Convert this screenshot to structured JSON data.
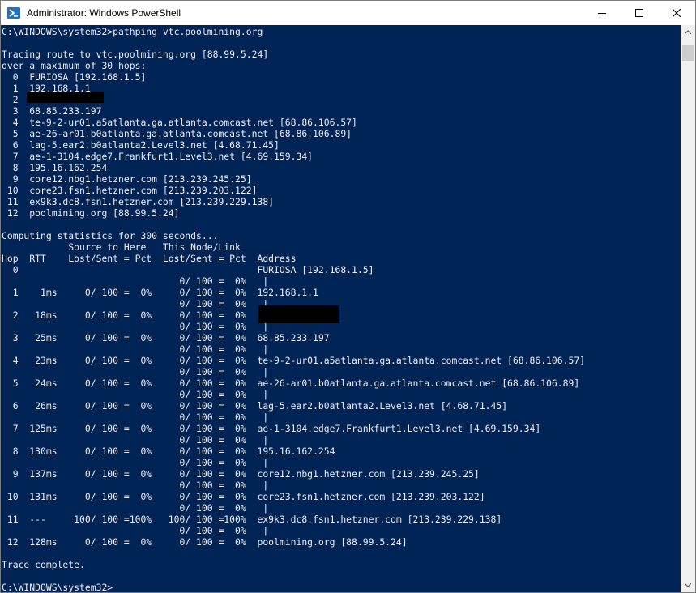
{
  "window": {
    "title": "Administrator: Windows PowerShell",
    "icon": "powershell-icon",
    "controls": [
      "minimize-icon",
      "maximize-icon",
      "close-icon"
    ],
    "colors": {
      "console_bg": "#012456",
      "console_fg": "#eeedf0",
      "titlebar_bg": "#ffffff"
    }
  },
  "console": {
    "lines": [
      "C:\\WINDOWS\\system32>pathping vtc.poolmining.org",
      "",
      "Tracing route to vtc.poolmining.org [88.99.5.24]",
      "over a maximum of 30 hops:",
      "  0  FURIOSA [192.168.1.5]",
      "  1  192.168.1.1",
      "  2",
      "  3  68.85.233.197",
      "  4  te-9-2-ur01.a5atlanta.ga.atlanta.comcast.net [68.86.106.57]",
      "  5  ae-26-ar01.b0atlanta.ga.atlanta.comcast.net [68.86.106.89]",
      "  6  lag-5.ear2.b0atlanta2.Level3.net [4.68.71.45]",
      "  7  ae-1-3104.edge7.Frankfurt1.Level3.net [4.69.159.34]",
      "  8  195.16.162.254",
      "  9  core12.nbg1.hetzner.com [213.239.245.25]",
      " 10  core23.fsn1.hetzner.com [213.239.203.122]",
      " 11  ex9k3.dc8.fsn1.hetzner.com [213.239.229.138]",
      " 12  poolmining.org [88.99.5.24]",
      "",
      "Computing statistics for 300 seconds...",
      "            Source to Here   This Node/Link",
      "Hop  RTT    Lost/Sent = Pct  Lost/Sent = Pct  Address",
      "  0                                           FURIOSA [192.168.1.5]",
      "                                0/ 100 =  0%   |",
      "  1    1ms     0/ 100 =  0%     0/ 100 =  0%  192.168.1.1",
      "                                0/ 100 =  0%   |",
      "  2   18ms     0/ 100 =  0%     0/ 100 =  0%",
      "                                0/ 100 =  0%   |",
      "  3   25ms     0/ 100 =  0%     0/ 100 =  0%  68.85.233.197",
      "                                0/ 100 =  0%   |",
      "  4   23ms     0/ 100 =  0%     0/ 100 =  0%  te-9-2-ur01.a5atlanta.ga.atlanta.comcast.net [68.86.106.57]",
      "                                0/ 100 =  0%   |",
      "  5   24ms     0/ 100 =  0%     0/ 100 =  0%  ae-26-ar01.b0atlanta.ga.atlanta.comcast.net [68.86.106.89]",
      "                                0/ 100 =  0%   |",
      "  6   26ms     0/ 100 =  0%     0/ 100 =  0%  lag-5.ear2.b0atlanta2.Level3.net [4.68.71.45]",
      "                                0/ 100 =  0%   |",
      "  7  125ms     0/ 100 =  0%     0/ 100 =  0%  ae-1-3104.edge7.Frankfurt1.Level3.net [4.69.159.34]",
      "                                0/ 100 =  0%   |",
      "  8  130ms     0/ 100 =  0%     0/ 100 =  0%  195.16.162.254",
      "                                0/ 100 =  0%   |",
      "  9  137ms     0/ 100 =  0%     0/ 100 =  0%  core12.nbg1.hetzner.com [213.239.245.25]",
      "                                0/ 100 =  0%   |",
      " 10  131ms     0/ 100 =  0%     0/ 100 =  0%  core23.fsn1.hetzner.com [213.239.203.122]",
      "                                0/ 100 =  0%   |",
      " 11  ---     100/ 100 =100%   100/ 100 =100%  ex9k3.dc8.fsn1.hetzner.com [213.239.229.138]",
      "                                0/ 100 =  0%   |",
      " 12  128ms     0/ 100 =  0%     0/ 100 =  0%  poolmining.org [88.99.5.24]",
      "",
      "Trace complete.",
      "",
      "C:\\WINDOWS\\system32>"
    ]
  }
}
